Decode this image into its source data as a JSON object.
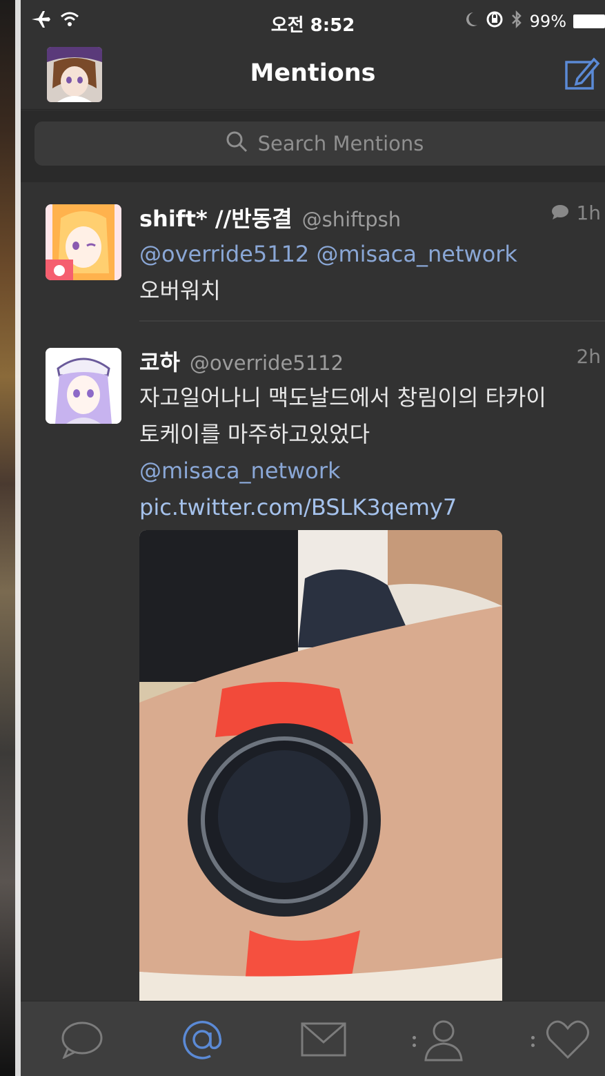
{
  "status_bar": {
    "time": "오전 8:52",
    "battery_label": "99%",
    "icons": [
      "airplane-icon",
      "wifi-icon",
      "moon-icon",
      "rotation-lock-icon",
      "bluetooth-icon",
      "battery-icon"
    ]
  },
  "nav": {
    "title": "Mentions",
    "compose_icon": "compose-icon"
  },
  "search": {
    "placeholder": "Search Mentions"
  },
  "tweets": [
    {
      "name": "shift* //반동결",
      "handle": "@shiftpsh",
      "time": "1h",
      "has_reply_icon": true,
      "text_mentions": "@override5112 @misaca_network",
      "text": "오버워치"
    },
    {
      "name": "코하",
      "handle": "@override5112",
      "time": "2h",
      "text": "자고일어나니 맥도날드에서 창림이의 타카이 토케이를 마주하고있었다",
      "mention": "@misaca_network",
      "link": "pic.twitter.com/BSLK3qemy7"
    }
  ],
  "tabbar": {
    "tabs": [
      "timeline-icon",
      "mentions-icon",
      "messages-icon",
      "profile-icon",
      "favorites-icon"
    ],
    "active": "mentions-icon"
  },
  "colors": {
    "background": "#323232",
    "mention": "#8aa7d6",
    "active_tab": "#5b8ad6",
    "inactive_tab": "#7c7c7c"
  }
}
